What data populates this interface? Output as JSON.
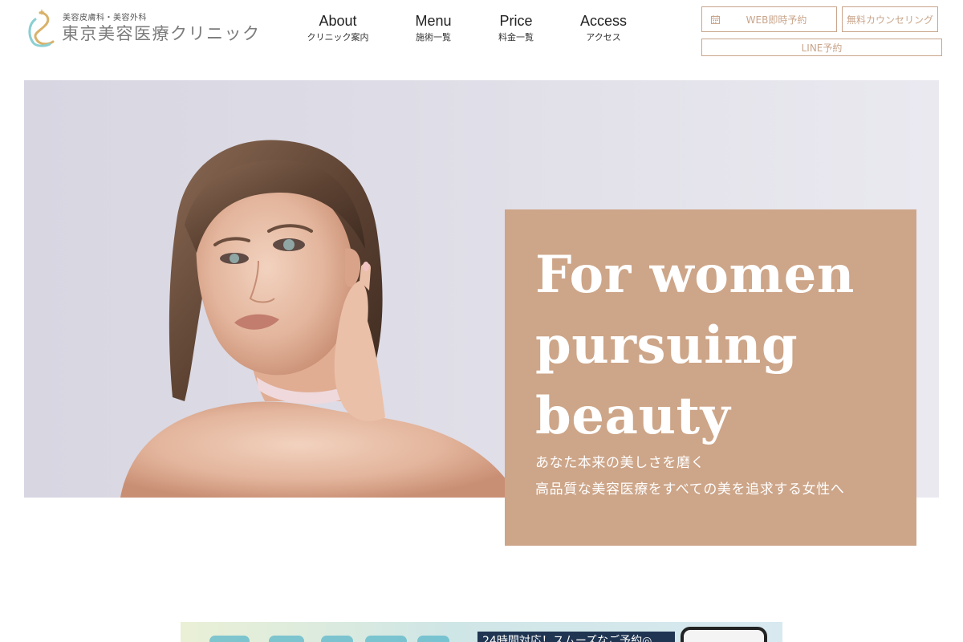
{
  "header": {
    "logo_subtitle": "美容皮膚科・美容外科",
    "logo_title": "東京美容医療クリニック",
    "nav": [
      {
        "label": "About",
        "sublabel": "クリニック案内"
      },
      {
        "label": "Menu",
        "sublabel": "施術一覧"
      },
      {
        "label": "Price",
        "sublabel": "料金一覧"
      },
      {
        "label": "Access",
        "sublabel": "アクセス"
      }
    ],
    "buttons": {
      "web_reserve": "WEB即時予約",
      "counseling": "無料カウンセリング",
      "line_reserve": "LINE予約"
    }
  },
  "hero": {
    "title_lines": [
      "For women",
      "pursuing",
      "beauty"
    ],
    "lead_lines": [
      "あなた本来の美しさを磨く",
      "高品質な美容医療をすべての美を追求する女性へ"
    ]
  },
  "banner": {
    "text": "24時間対応！スムーズなご予約◎"
  },
  "colors": {
    "accent": "#cda588",
    "button_border": "#c9a58b",
    "hero_background": "#dedce6",
    "logo_gold": "#d9b26a",
    "logo_teal": "#8ccfd2"
  }
}
